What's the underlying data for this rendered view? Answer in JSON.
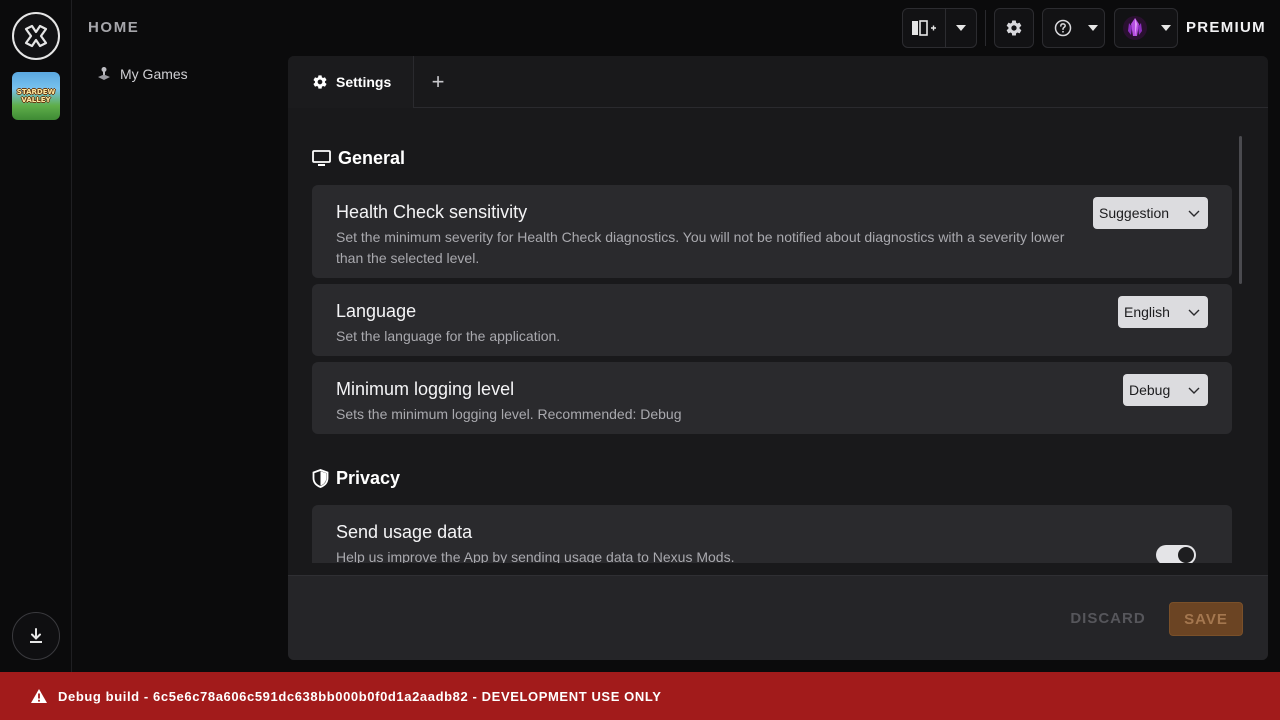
{
  "rail": {
    "logo_icon": "nexus-app-logo-icon",
    "game_tile_text": "STARDEW VALLEY",
    "download_icon": "download-icon"
  },
  "nav": {
    "title": "HOME",
    "items": [
      {
        "label": "My Games",
        "icon": "joystick-icon"
      }
    ]
  },
  "toolbar": {
    "panel_layout_icon": "panel-add-icon",
    "settings_icon": "gear-icon",
    "help_icon": "help-circle-icon",
    "avatar_icon": "crystal-avatar-icon",
    "premium_label": "PREMIUM"
  },
  "tabs": [
    {
      "label": "Settings",
      "icon": "gear-icon",
      "active": true
    }
  ],
  "add_tab_glyph": "+",
  "sections": {
    "general": {
      "title": "General",
      "icon": "monitor-icon",
      "settings": [
        {
          "title": "Health Check sensitivity",
          "description": "Set the minimum severity for Health Check diagnostics. You will not be notified about diagnostics with a severity lower than the selected level.",
          "value": "Suggestion"
        },
        {
          "title": "Language",
          "description": "Set the language for the application.",
          "value": "English"
        },
        {
          "title": "Minimum logging level",
          "description": "Sets the minimum logging level. Recommended: Debug",
          "value": "Debug"
        }
      ]
    },
    "privacy": {
      "title": "Privacy",
      "icon": "shield-icon",
      "settings": [
        {
          "title": "Send usage data",
          "description": "Help us improve the App by sending usage data to Nexus Mods.",
          "enabled": true
        }
      ]
    }
  },
  "footer": {
    "discard_label": "DISCARD",
    "save_label": "SAVE"
  },
  "debug_bar": {
    "icon": "warning-icon",
    "text": "Debug build - 6c5e6c78a606c591dc638bb000b0f0d1a2aadb82 - DEVELOPMENT USE ONLY"
  },
  "colors": {
    "background": "#0b0b0c",
    "panel": "#19191b",
    "card": "#2a2a2d",
    "debug_red": "#a21b1b",
    "save_brown": "#6b4423"
  }
}
